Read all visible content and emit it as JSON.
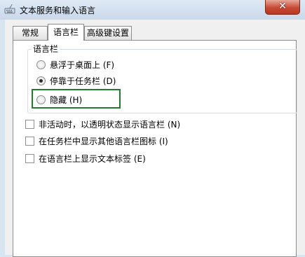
{
  "window": {
    "title": "文本服务和输入语言",
    "close_glyph": "✕",
    "icon": "keyboard-icon"
  },
  "tabs": [
    {
      "label": "常规",
      "active": false
    },
    {
      "label": "语言栏",
      "active": true
    },
    {
      "label": "高级键设置",
      "active": false
    }
  ],
  "langbar_group": {
    "title": "语言栏",
    "options": [
      {
        "label": "悬浮于桌面上 (F)",
        "selected": false
      },
      {
        "label": "停靠于任务栏 (D)",
        "selected": true
      },
      {
        "label": "隐藏 (H)",
        "selected": false
      }
    ]
  },
  "checkboxes": [
    {
      "label": "非活动时，以透明状态显示语言栏 (N)",
      "checked": false
    },
    {
      "label": "在任务栏中显示其他语言栏图标 (I)",
      "checked": false
    },
    {
      "label": "在语言栏上显示文本标签 (E)",
      "checked": false
    }
  ],
  "colors": {
    "highlight_border": "#1e7c2c",
    "close_button": "#c74a36"
  }
}
